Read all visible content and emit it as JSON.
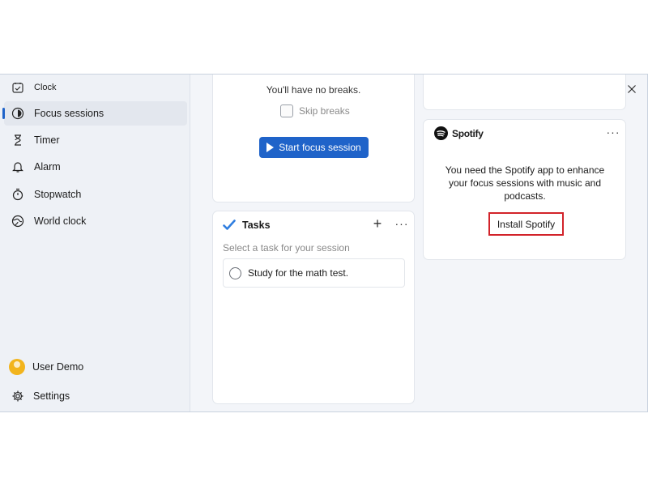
{
  "app": {
    "title": "Clock",
    "icon": "clock-app-icon"
  },
  "sidebar": {
    "items": [
      {
        "label": "Focus sessions",
        "icon": "focus-icon",
        "active": true
      },
      {
        "label": "Timer",
        "icon": "hourglass-icon"
      },
      {
        "label": "Alarm",
        "icon": "bell-icon"
      },
      {
        "label": "Stopwatch",
        "icon": "stopwatch-icon"
      },
      {
        "label": "World clock",
        "icon": "globe-icon"
      }
    ],
    "user": {
      "name": "User Demo",
      "icon": "avatar"
    },
    "settings": {
      "label": "Settings",
      "icon": "gear-icon"
    }
  },
  "window_controls": [
    "minimize-icon",
    "maximize-icon",
    "close-icon"
  ],
  "focus_card": {
    "message": "You'll have no breaks.",
    "skip_breaks_label": "Skip breaks",
    "skip_breaks_checked": false,
    "start_button_label": "Start focus session"
  },
  "tasks_card": {
    "title": "Tasks",
    "subtitle": "Select a task for your session",
    "items": [
      {
        "label": "Study for the math test.",
        "done": false
      }
    ]
  },
  "spotify_card": {
    "title": "Spotify",
    "description": "You need the Spotify app to enhance your focus sessions with music and podcasts.",
    "install_button_label": "Install Spotify"
  },
  "colors": {
    "accent": "#1f63c9",
    "highlight_border": "#d2232a",
    "spotify_logo": "#111111"
  }
}
